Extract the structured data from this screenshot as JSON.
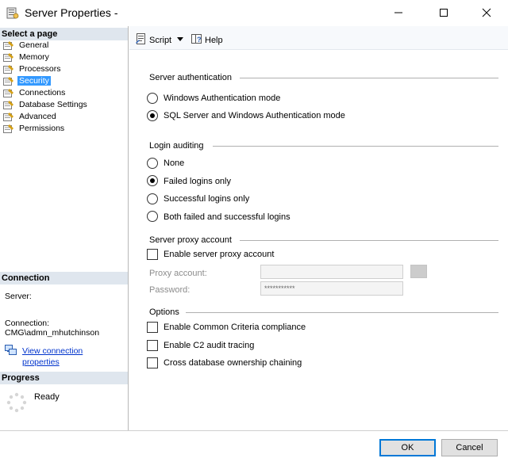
{
  "window": {
    "title": "Server Properties -",
    "minimize_label": "Minimize",
    "maximize_label": "Maximize",
    "close_label": "Close"
  },
  "left": {
    "select_page_header": "Select a page",
    "pages": [
      {
        "label": "General",
        "selected": false
      },
      {
        "label": "Memory",
        "selected": false
      },
      {
        "label": "Processors",
        "selected": false
      },
      {
        "label": "Security",
        "selected": true
      },
      {
        "label": "Connections",
        "selected": false
      },
      {
        "label": "Database Settings",
        "selected": false
      },
      {
        "label": "Advanced",
        "selected": false
      },
      {
        "label": "Permissions",
        "selected": false
      }
    ],
    "connection_header": "Connection",
    "server_label": "Server:",
    "connection_label": "Connection:",
    "connection_value": "CMG\\admn_mhutchinson",
    "view_connection_line1": "View connection",
    "view_connection_line2": "properties",
    "progress_header": "Progress",
    "progress_status": "Ready"
  },
  "toolbar": {
    "script_label": "Script",
    "help_label": "Help"
  },
  "server_auth": {
    "title": "Server authentication",
    "options": [
      {
        "label": "Windows Authentication mode",
        "selected": false
      },
      {
        "label": "SQL Server and Windows Authentication mode",
        "selected": true
      }
    ]
  },
  "login_auditing": {
    "title": "Login auditing",
    "options": [
      {
        "label": "None",
        "selected": false
      },
      {
        "label": "Failed logins only",
        "selected": true
      },
      {
        "label": "Successful logins only",
        "selected": false
      },
      {
        "label": "Both failed and successful logins",
        "selected": false
      }
    ]
  },
  "proxy": {
    "title": "Server proxy account",
    "enable_label": "Enable server proxy account",
    "enable_checked": false,
    "account_label": "Proxy account:",
    "account_value": "",
    "password_label": "Password:",
    "password_value": "***********"
  },
  "options": {
    "title": "Options",
    "items": [
      {
        "label": "Enable Common Criteria compliance",
        "checked": false
      },
      {
        "label": "Enable C2 audit tracing",
        "checked": false
      },
      {
        "label": "Cross database ownership chaining",
        "checked": false
      }
    ]
  },
  "buttons": {
    "ok_label": "OK",
    "cancel_label": "Cancel"
  }
}
